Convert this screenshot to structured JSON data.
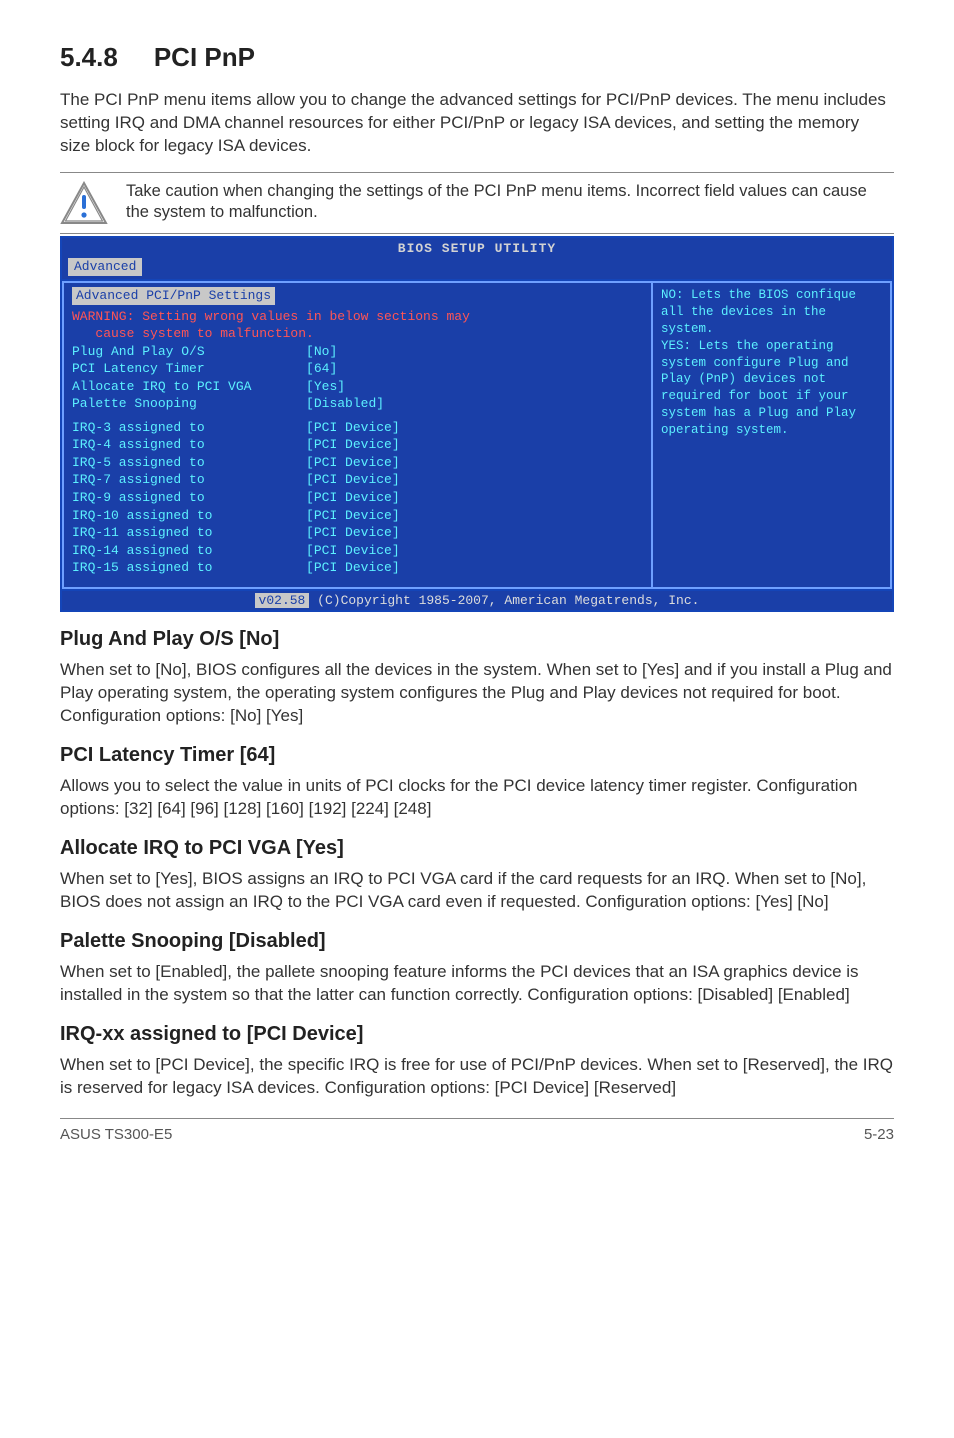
{
  "section": {
    "number": "5.4.8",
    "title": "PCI PnP"
  },
  "intro": "The PCI PnP menu items allow you to change the advanced settings for PCI/PnP devices. The menu includes setting IRQ and DMA channel resources for either PCI/PnP or legacy ISA devices, and setting the memory size block for legacy ISA devices.",
  "caution": "Take caution when changing the settings of the PCI PnP menu items. Incorrect field values can cause the system to malfunction.",
  "bios": {
    "title": "BIOS SETUP UTILITY",
    "tab": "Advanced",
    "panel_heading": "Advanced PCI/PnP Settings",
    "warning_l1": "WARNING: Setting wrong values in below sections may",
    "warning_l2": "   cause system to malfunction.",
    "rows": [
      {
        "label": "Plug And Play O/S",
        "value": "[No]"
      },
      {
        "label": "PCI Latency Timer",
        "value": "[64]"
      },
      {
        "label": "Allocate IRQ to PCI VGA",
        "value": "[Yes]"
      },
      {
        "label": "Palette Snooping",
        "value": "[Disabled]"
      }
    ],
    "irq_rows": [
      {
        "label": "IRQ-3 assigned to",
        "value": "[PCI Device]"
      },
      {
        "label": "IRQ-4 assigned to",
        "value": "[PCI Device]"
      },
      {
        "label": "IRQ-5 assigned to",
        "value": "[PCI Device]"
      },
      {
        "label": "IRQ-7 assigned to",
        "value": "[PCI Device]"
      },
      {
        "label": "IRQ-9 assigned to",
        "value": "[PCI Device]"
      },
      {
        "label": "IRQ-10 assigned to",
        "value": "[PCI Device]"
      },
      {
        "label": "IRQ-11 assigned to",
        "value": "[PCI Device]"
      },
      {
        "label": "IRQ-14 assigned to",
        "value": "[PCI Device]"
      },
      {
        "label": "IRQ-15 assigned to",
        "value": "[PCI Device]"
      }
    ],
    "help": "NO: Lets the BIOS confique all the devices in the system.\nYES: Lets the operating system configure Plug and Play (PnP) devices not required for boot if your system has a Plug and Play operating system.",
    "copyright_prefix": "v02.58",
    "copyright": " (C)Copyright 1985-2007, American Megatrends, Inc."
  },
  "subs": [
    {
      "title": "Plug And Play O/S [No]",
      "body": "When set to [No], BIOS configures all the devices in the system. When set to [Yes] and if you install a Plug and Play operating system, the operating system configures the Plug and Play devices not required for boot. Configuration options: [No] [Yes]"
    },
    {
      "title": "PCI Latency Timer [64]",
      "body": "Allows you to select the value in units of PCI clocks for the PCI device latency timer register. Configuration options: [32] [64] [96] [128] [160] [192] [224] [248]"
    },
    {
      "title": "Allocate IRQ to PCI VGA [Yes]",
      "body": "When set to [Yes], BIOS assigns an IRQ to PCI VGA card if the card requests for an IRQ. When set to [No], BIOS does not assign an IRQ to the PCI VGA card even if requested. Configuration options: [Yes] [No]"
    },
    {
      "title": "Palette Snooping [Disabled]",
      "body": "When set to [Enabled], the pallete snooping feature informs the PCI devices that an ISA graphics device is installed in the system so that the latter can function correctly. Configuration options: [Disabled] [Enabled]"
    },
    {
      "title": "IRQ-xx assigned to [PCI Device]",
      "body": "When set to [PCI Device], the specific IRQ is free for use of PCI/PnP devices. When set to [Reserved], the IRQ is reserved for legacy ISA devices. Configuration options: [PCI Device] [Reserved]"
    }
  ],
  "footer": {
    "left": "ASUS TS300-E5",
    "right": "5-23"
  }
}
